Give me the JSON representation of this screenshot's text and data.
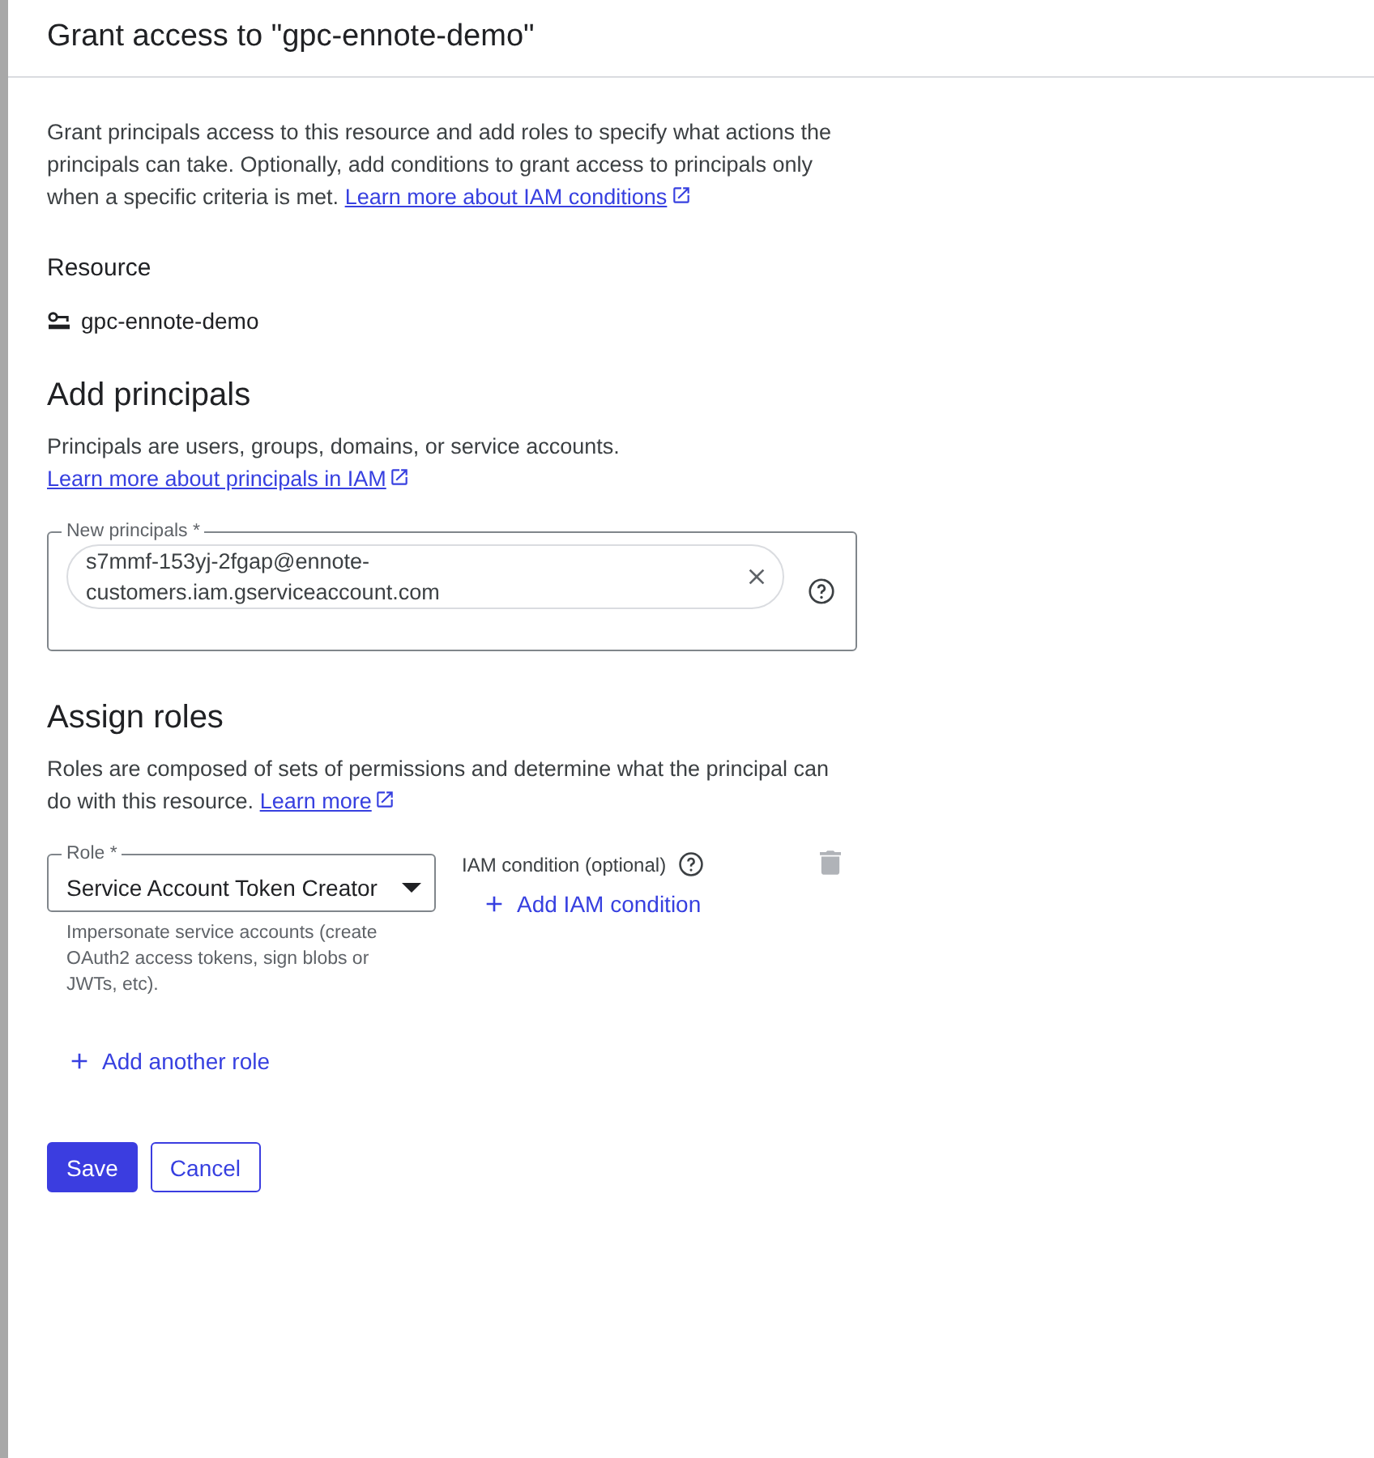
{
  "dialog": {
    "title": "Grant access to \"gpc-ennote-demo\""
  },
  "intro": {
    "text": "Grant principals access to this resource and add roles to specify what actions the principals can take. Optionally, add conditions to grant access to principals only when a specific criteria is met.",
    "link": "Learn more about IAM conditions"
  },
  "resource": {
    "heading": "Resource",
    "name": "gpc-ennote-demo"
  },
  "add_principals": {
    "heading": "Add principals",
    "text": "Principals are users, groups, domains, or service accounts.",
    "link": "Learn more about principals in IAM",
    "field": {
      "label": "New principals *",
      "chip": "s7mmf-153yj-2fgap@ennote-customers.iam.gserviceaccount.com"
    }
  },
  "assign_roles": {
    "heading": "Assign roles",
    "text": "Roles are composed of sets of permissions and determine what the principal can do with this resource.",
    "link": "Learn more",
    "roles": [
      {
        "label": "Role *",
        "value": "Service Account Token Creator",
        "hint": "Impersonate service accounts (create OAuth2 access tokens, sign blobs or JWTs, etc).",
        "condition_label": "IAM condition (optional)",
        "add_condition": "Add IAM condition",
        "delete_disabled": true
      }
    ],
    "add_role": "Add another role"
  },
  "buttons": [
    {
      "label": "Save",
      "kind": "primary"
    },
    {
      "label": "Cancel",
      "kind": "secondary"
    }
  ]
}
